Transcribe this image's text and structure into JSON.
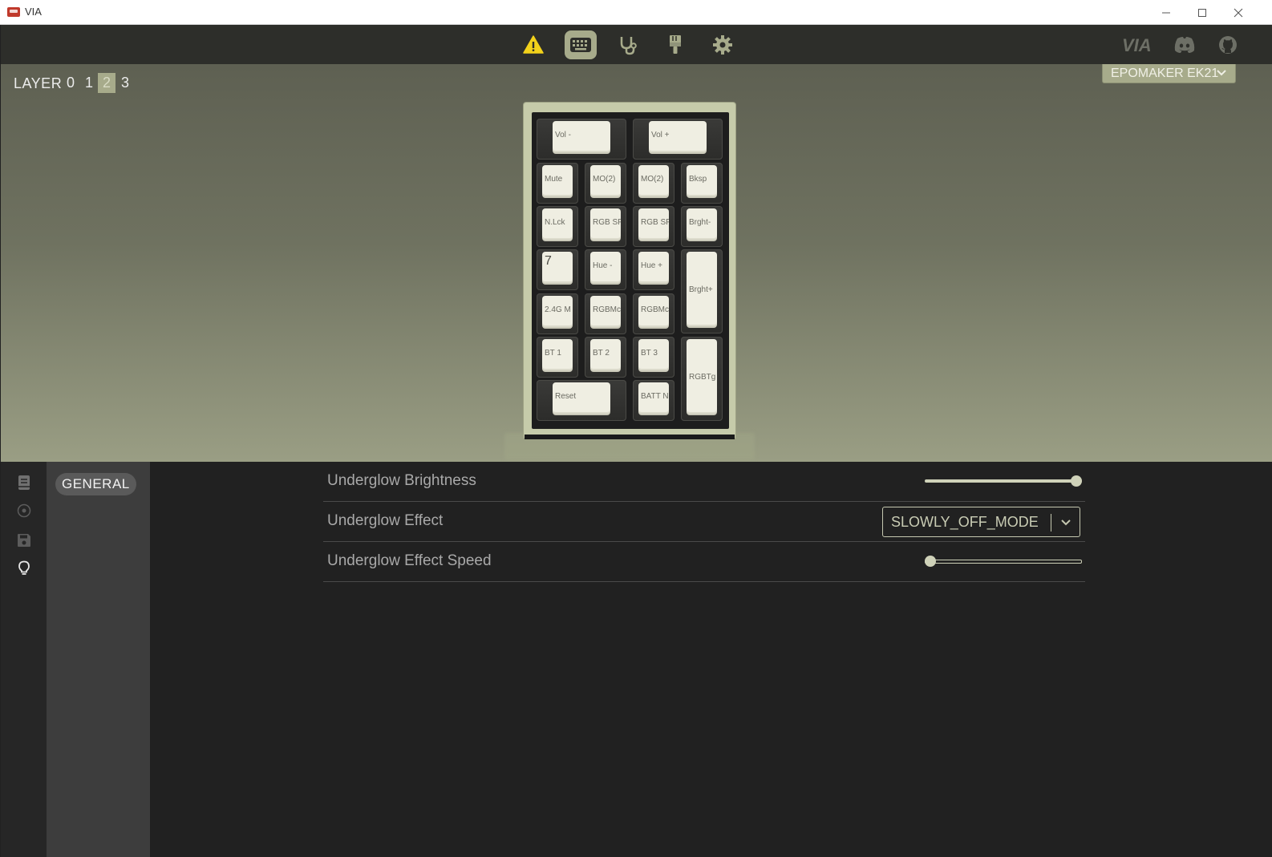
{
  "window": {
    "title": "VIA",
    "controls": [
      "minimize",
      "maximize",
      "close"
    ]
  },
  "toolbar": {
    "icons": [
      "warning-icon",
      "keyboard-icon",
      "stethoscope-icon",
      "paintbrush-icon",
      "gear-icon"
    ],
    "active": "keyboard-icon",
    "right_links": [
      "VIA",
      "discord-icon",
      "github-icon"
    ],
    "via_logo_text": "VIA"
  },
  "layers": {
    "label": "LAYER",
    "items": [
      "0",
      "1",
      "2",
      "3"
    ],
    "selected": "2"
  },
  "device": {
    "name": "EPOMAKER EK21"
  },
  "keyboard": {
    "keys": [
      {
        "label": "Vol -"
      },
      {
        "label": "Vol +"
      },
      {
        "label": "Mute"
      },
      {
        "label": "MO(2)"
      },
      {
        "label": "MO(2)"
      },
      {
        "label": "Bksp"
      },
      {
        "label": "N.Lck"
      },
      {
        "label": "RGB SF"
      },
      {
        "label": "RGB SF"
      },
      {
        "label": "Brght-"
      },
      {
        "label": "7"
      },
      {
        "label": "Hue -"
      },
      {
        "label": "Hue +"
      },
      {
        "label": "Brght+"
      },
      {
        "label": "2.4G M"
      },
      {
        "label": "RGBMc"
      },
      {
        "label": "RGBMc"
      },
      {
        "label": "BT 1"
      },
      {
        "label": "BT 2"
      },
      {
        "label": "BT 3"
      },
      {
        "label": "RGBTg"
      },
      {
        "label": "Reset"
      },
      {
        "label": "BATT N"
      }
    ]
  },
  "sidebar": {
    "rail_icons": [
      "book-icon",
      "circle-dot-icon",
      "save-icon",
      "lightbulb-icon"
    ],
    "active_icon": "lightbulb-icon",
    "menu": {
      "items": [
        "GENERAL"
      ],
      "selected": "GENERAL"
    }
  },
  "settings": {
    "brightness": {
      "label": "Underglow Brightness",
      "value_fraction": 1.0
    },
    "effect": {
      "label": "Underglow Effect",
      "value": "SLOWLY_OFF_MODE"
    },
    "speed": {
      "label": "Underglow Effect Speed",
      "value_fraction": 0.0
    }
  },
  "colors": {
    "accent": "#a7ab8b",
    "background": "#212121",
    "toolbar": "#2d2e2a"
  }
}
